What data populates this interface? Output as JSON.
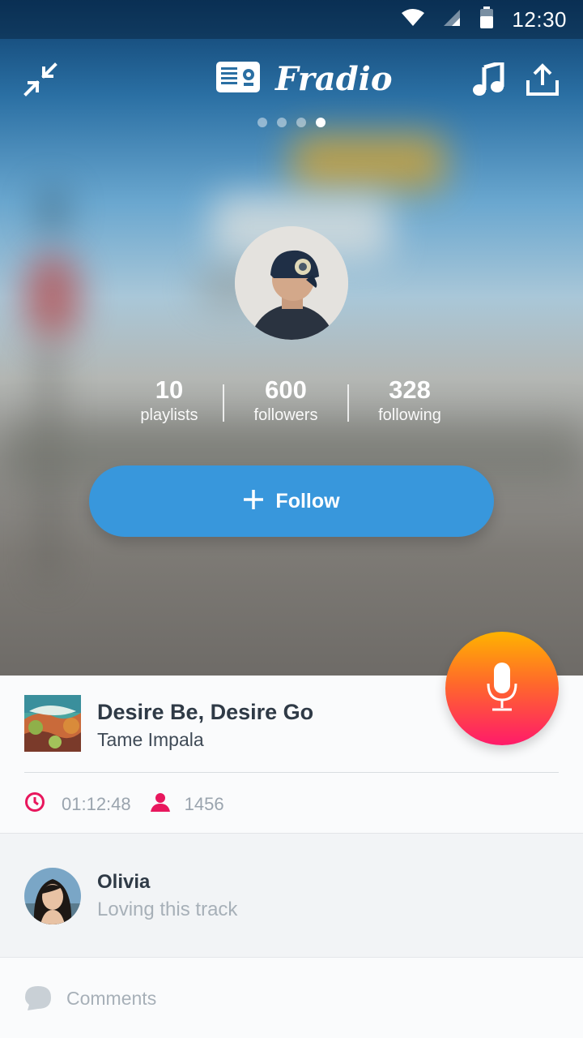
{
  "status_bar": {
    "time": "12:30",
    "icons": [
      "wifi-icon",
      "signal-icon",
      "battery-icon"
    ]
  },
  "header": {
    "brand_name": "Fradio",
    "page_count": 4,
    "active_page": 4
  },
  "profile": {
    "stats": [
      {
        "value": "10",
        "label": "playlists"
      },
      {
        "value": "600",
        "label": "followers"
      },
      {
        "value": "328",
        "label": "following"
      }
    ],
    "follow_label": "Follow"
  },
  "now_playing": {
    "title": "Desire Be, Desire Go",
    "artist": "Tame Impala",
    "duration": "01:12:48",
    "listeners": "1456"
  },
  "comment": {
    "name": "Olivia",
    "text": "Loving this track"
  },
  "comments_bar": {
    "placeholder": "Comments"
  },
  "colors": {
    "accent_blue": "#3897dc",
    "accent_pink": "#e8175d",
    "mic_gradient_top": "#ffb300",
    "mic_gradient_bottom": "#ff1a6a"
  }
}
